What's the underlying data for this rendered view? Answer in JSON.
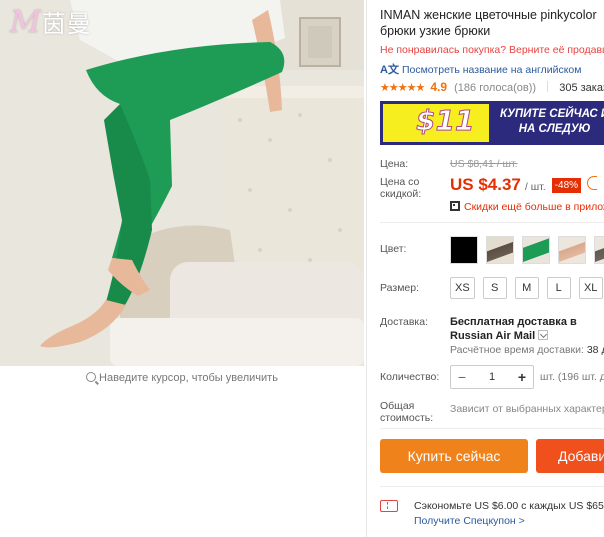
{
  "gallery": {
    "brand_logo_mark": "M",
    "brand_logo_text": "茵曼",
    "zoom_hint": "Наведите курсор, чтобы увеличить"
  },
  "product": {
    "title": "INMAN женские цветочные pinkycolor брюки узкие брюки",
    "return_note": "Не понравилась покупка? Верните её продавцу",
    "translate_link": "Посмотреть название на английском",
    "rating": {
      "stars": "★★★★★",
      "value": "4.9",
      "votes": "(186 голоса(ов))",
      "orders": "305 заказ"
    }
  },
  "banner": {
    "price": "$11",
    "line1": "КУПИТЕ СЕЙЧАС И",
    "line2": "НА СЛЕДУЮ"
  },
  "price": {
    "label": "Цена:",
    "old": "US $8,41 / шт.",
    "discount_label_1": "Цена со",
    "discount_label_2": "скидкой:",
    "new": "US $4.37",
    "unit": "/ шт.",
    "discount": "-48%",
    "app_promo": "Скидки ещё больше в прилож"
  },
  "color": {
    "label": "Цвет:",
    "swatches": [
      "black",
      "brown-print",
      "green",
      "nude",
      "grey"
    ]
  },
  "size": {
    "label": "Размер:",
    "options": [
      "XS",
      "S",
      "M",
      "L",
      "XL"
    ]
  },
  "shipping": {
    "label": "Доставка:",
    "title": "Бесплатная доставка в Russian Air Mail",
    "time_label": "Расчётное время доставки:",
    "time_value": "38 д"
  },
  "quantity": {
    "label": "Количество:",
    "minus": "−",
    "value": "1",
    "plus": "+",
    "note": "шт. (196 шт. д"
  },
  "total": {
    "label_1": "Общая",
    "label_2": "стоимость:",
    "note": "Зависит от выбранных характер"
  },
  "actions": {
    "buy": "Купить сейчас",
    "cart": "Добави"
  },
  "coupon": {
    "line1": "Сэкономьте US $6.00 с каждых US $65.00",
    "line2": "Получите Спецкупон >"
  },
  "colors": {
    "accent": "#e62e04",
    "buy_button": "#f0821c",
    "cart_button": "#f0501c",
    "link": "#2a5a9e",
    "rating": "#f0710e"
  }
}
